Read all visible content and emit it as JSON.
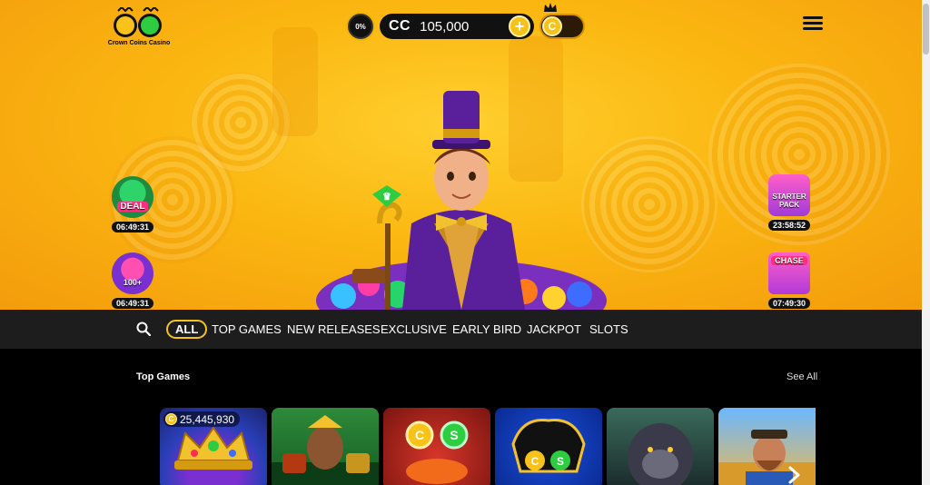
{
  "brand": {
    "logo_text": "Crown Coins Casino",
    "logo_letters": "CS"
  },
  "header": {
    "percent_badge": "0%",
    "balance_currency": "CC",
    "balance_value": "105,000",
    "add_coins_label": "+",
    "coin_toggle_letter": "C",
    "menu_icon": "hamburger-icon"
  },
  "promos": {
    "deal": {
      "label": "DEAL",
      "timer": "06:49:31"
    },
    "hundred": {
      "label": "100+",
      "timer": "06:49:31"
    },
    "starter_pack": {
      "label": "STARTER PACK",
      "timer": "23:58:52"
    },
    "chase": {
      "label": "CHASE",
      "timer": "07:49:30"
    }
  },
  "nav": {
    "search_icon": "search-icon",
    "tabs": [
      {
        "label": "ALL",
        "active": true
      },
      {
        "label": "TOP GAMES"
      },
      {
        "label": "NEW RELEASES"
      },
      {
        "label": "EXCLUSIVE"
      },
      {
        "label": "EARLY BIRD"
      },
      {
        "label": "JACKPOT"
      },
      {
        "label": "SLOTS"
      }
    ]
  },
  "section": {
    "title": "Top Games",
    "see_all": "See All",
    "tiles": [
      {
        "jackpot": "25,445,930",
        "coin": "C"
      },
      {},
      {},
      {},
      {},
      {}
    ]
  },
  "colors": {
    "accent": "#f7c21a",
    "hero_bg": "#fbb711",
    "nav_bg": "#1d1d1d",
    "page_bg": "#000000"
  }
}
